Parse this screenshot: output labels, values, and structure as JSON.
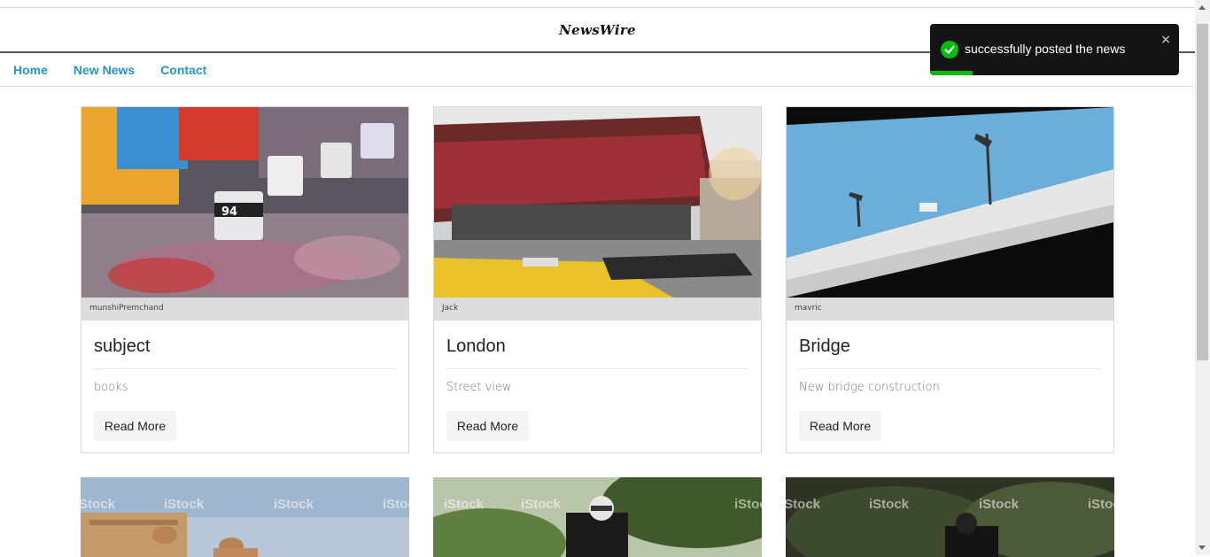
{
  "brand": "NewsWire",
  "nav": [
    "Home",
    "New News",
    "Contact"
  ],
  "toast": {
    "message": "successfully posted the news",
    "close": "×",
    "progress": 0.17
  },
  "cards": [
    {
      "author": "munshiPremchand",
      "title": "subject",
      "description": "books",
      "button": "Read More"
    },
    {
      "author": "Jack",
      "title": "London",
      "description": "Street view",
      "button": "Read More"
    },
    {
      "author": "mavric",
      "title": "Bridge",
      "description": "New bridge construction",
      "button": "Read More"
    }
  ],
  "watermark": "iStock"
}
